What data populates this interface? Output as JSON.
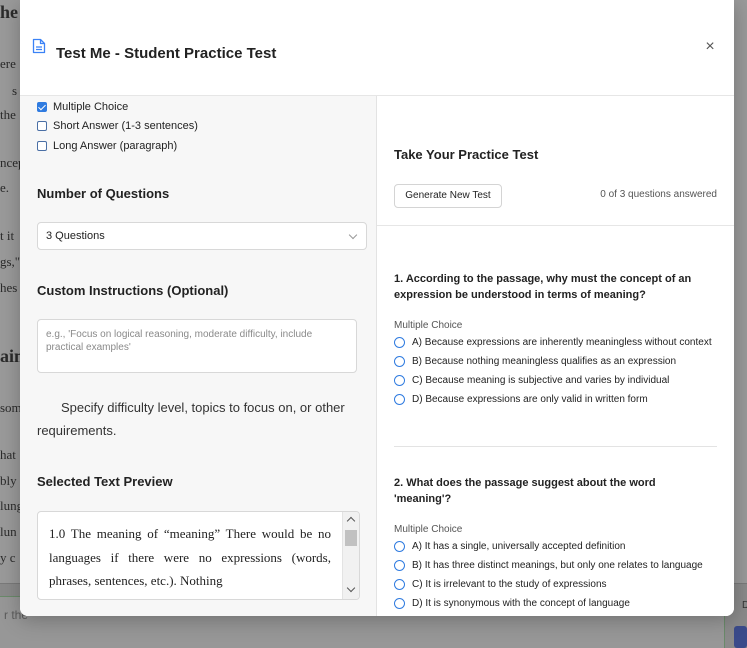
{
  "background": {
    "fragments": [
      "he",
      "ere",
      "s",
      "the",
      "ncep",
      "e.",
      "t it",
      "gs,\"",
      "hes",
      "ain",
      "som",
      "hat",
      "bly",
      "lung",
      "lun",
      "y c",
      "r the"
    ],
    "input_placeholder": "r the",
    "side_label": "D"
  },
  "modal": {
    "title": "Test Me - Student Practice Test",
    "close_label": "×"
  },
  "left": {
    "question_types": [
      {
        "label": "Multiple Choice",
        "checked": true
      },
      {
        "label": "Short Answer (1-3 sentences)",
        "checked": false
      },
      {
        "label": "Long Answer (paragraph)",
        "checked": false
      }
    ],
    "num_questions_title": "Number of Questions",
    "num_questions_value": "3 Questions",
    "custom_title": "Custom Instructions (Optional)",
    "custom_placeholder": "e.g., 'Focus on logical reasoning, moderate difficulty, include practical examples'",
    "helper_text": "Specify difficulty level, topics to focus on, or other requirements.",
    "preview_title": "Selected Text Preview",
    "preview_text": "1.0 The meaning of “meaning” There would be no languages if there were no expressions (words, phrases, sentences, etc.). Nothing"
  },
  "right": {
    "title": "Take Your Practice Test",
    "generate_label": "Generate New Test",
    "answered_text": "0 of 3 questions answered",
    "questions": [
      {
        "text": "1. According to the passage, why must the concept of an expression be understood in terms of meaning?",
        "type": "Multiple Choice",
        "options": [
          "A) Because expressions are inherently meaningless without context",
          "B) Because nothing meaningless qualifies as an expression",
          "C) Because meaning is subjective and varies by individual",
          "D) Because expressions are only valid in written form"
        ]
      },
      {
        "text": "2. What does the passage suggest about the word 'meaning'?",
        "type": "Multiple Choice",
        "options": [
          "A) It has a single, universally accepted definition",
          "B) It has three distinct meanings, but only one relates to language",
          "C) It is irrelevant to the study of expressions",
          "D) It is synonymous with the concept of language"
        ]
      }
    ]
  }
}
